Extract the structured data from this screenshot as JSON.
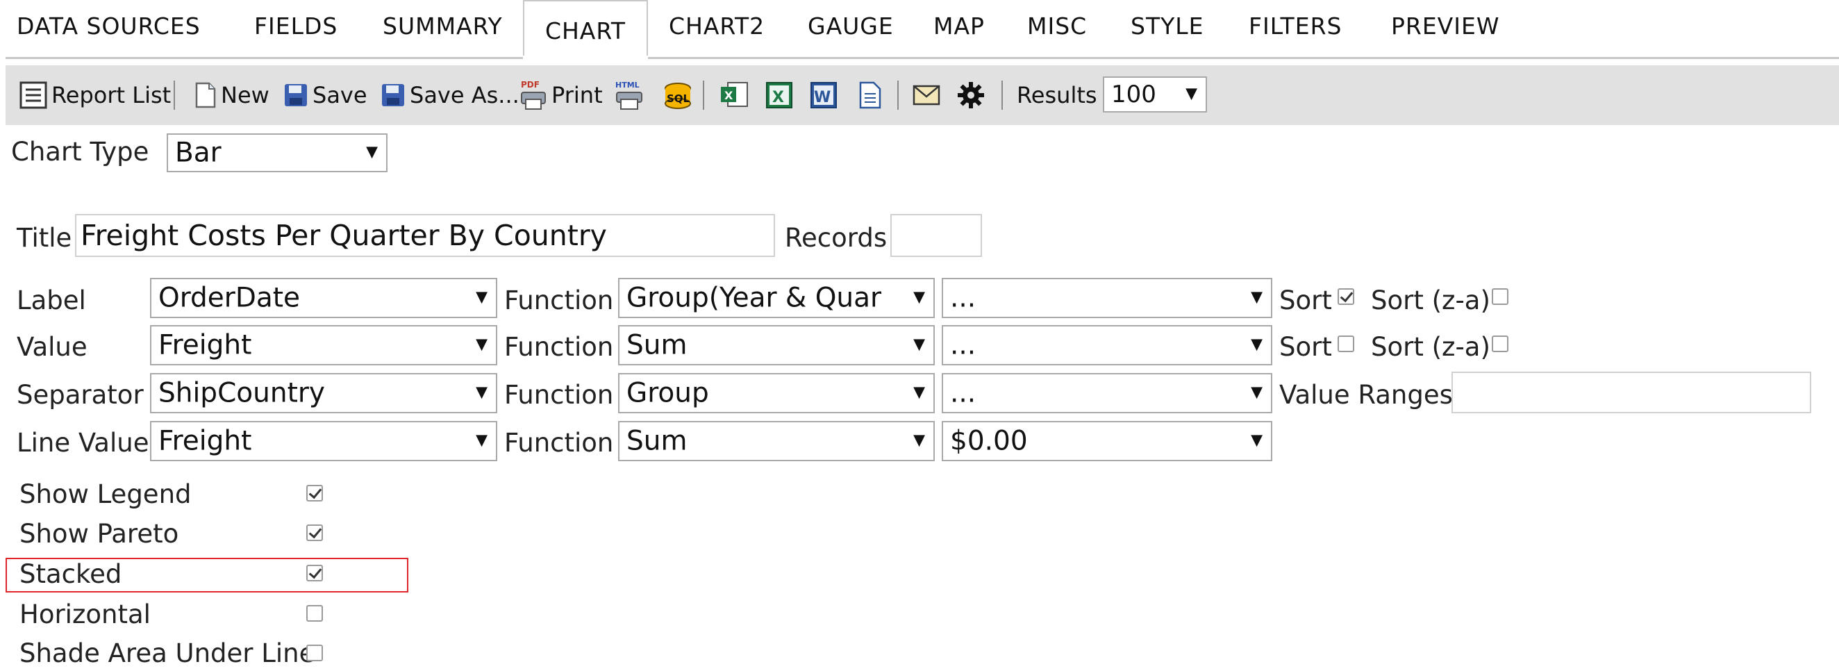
{
  "tabs": [
    "DATA SOURCES",
    "FIELDS",
    "SUMMARY",
    "CHART",
    "CHART2",
    "GAUGE",
    "MAP",
    "MISC",
    "STYLE",
    "FILTERS",
    "PREVIEW"
  ],
  "active_tab": "CHART",
  "toolbar": {
    "report_list": "Report List",
    "new": "New",
    "save": "Save",
    "save_as": "Save As...",
    "print": "Print",
    "results_label": "Results",
    "results_value": "100"
  },
  "chart_type": {
    "label": "Chart Type",
    "value": "Bar"
  },
  "title_field": {
    "label": "Title",
    "value": "Freight Costs Per Quarter By Country"
  },
  "records": {
    "label": "Records",
    "value": ""
  },
  "rows": {
    "label": {
      "name": "Label",
      "field": "OrderDate",
      "function_label": "Function",
      "function": "Group(Year & Quar",
      "format": "...",
      "sort_label": "Sort",
      "sort_checked": true,
      "sort_za_label": "Sort (z-a)",
      "sort_za_checked": false
    },
    "value": {
      "name": "Value",
      "field": "Freight",
      "function_label": "Function",
      "function": "Sum",
      "format": "...",
      "sort_label": "Sort",
      "sort_checked": false,
      "sort_za_label": "Sort (z-a)",
      "sort_za_checked": false
    },
    "separator": {
      "name": "Separator",
      "field": "ShipCountry",
      "function_label": "Function",
      "function": "Group",
      "format": "...",
      "value_ranges_label": "Value Ranges",
      "value_ranges": ""
    },
    "line_value": {
      "name": "Line Value",
      "field": "Freight",
      "function_label": "Function",
      "function": "Sum",
      "format": "$0.00"
    }
  },
  "options": [
    {
      "label": "Show Legend",
      "checked": true
    },
    {
      "label": "Show Pareto",
      "checked": true
    },
    {
      "label": "Stacked",
      "checked": true
    },
    {
      "label": "Horizontal",
      "checked": false
    },
    {
      "label": "Shade Area Under Line",
      "checked": false
    }
  ],
  "colors": {
    "toolbar_bg": "#e1e1e1",
    "highlight": "#e0262a",
    "tab_border": "#c8c8c8"
  },
  "icons": [
    "report-list-icon",
    "new-document-icon",
    "save-disk-icon",
    "save-as-disk-icon",
    "pdf-print-icon",
    "html-export-icon",
    "sql-icon",
    "excel-export-icon",
    "excel-icon",
    "word-icon",
    "document-icon",
    "email-icon",
    "gear-icon"
  ]
}
